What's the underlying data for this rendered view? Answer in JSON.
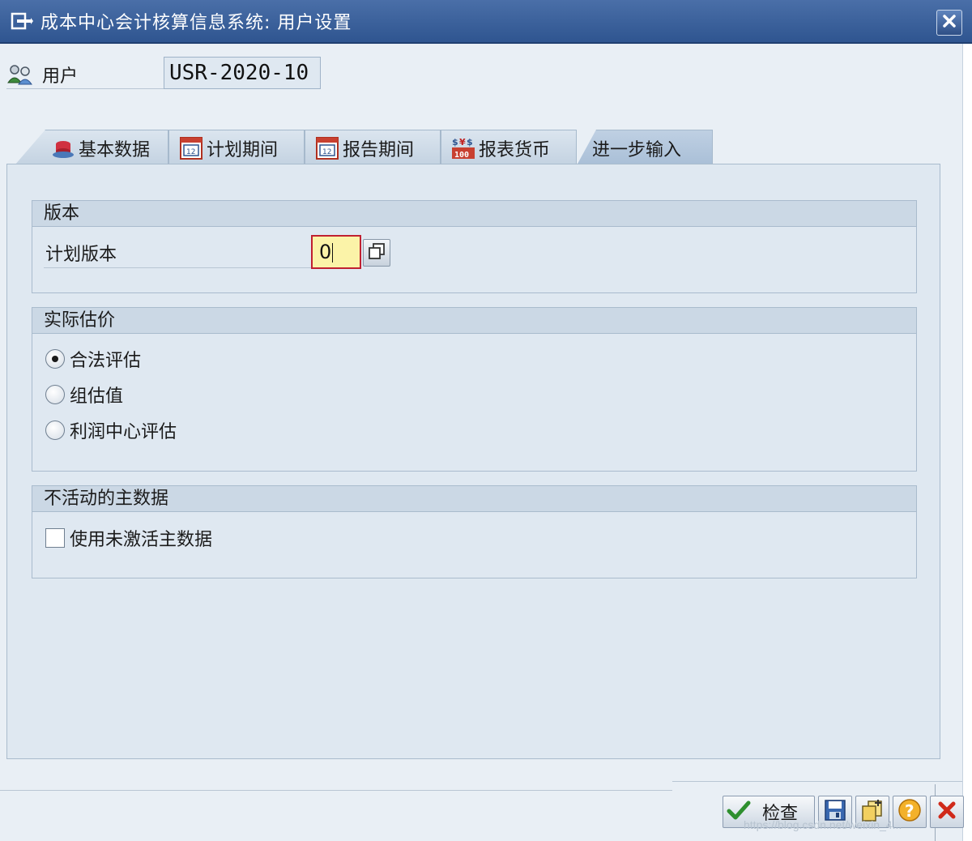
{
  "window": {
    "title": "成本中心会计核算信息系统: 用户设置",
    "app_icon": "edit-settings-icon",
    "close_icon": "close-icon"
  },
  "user": {
    "label": "用户",
    "value": "USR-2020-10",
    "icon": "users-icon"
  },
  "tabs": [
    {
      "label": "基本数据",
      "icon": "master-data-icon",
      "active": false
    },
    {
      "label": "计划期间",
      "icon": "calendar-icon",
      "active": false
    },
    {
      "label": "报告期间",
      "icon": "calendar-icon",
      "active": false
    },
    {
      "label": "报表货币",
      "icon": "currency-icon",
      "active": false
    },
    {
      "label": "进一步输入",
      "icon": "",
      "active": true
    }
  ],
  "groups": {
    "version": {
      "header": "版本",
      "plan_version_label": "计划版本",
      "plan_version_value": "0"
    },
    "actual_valuation": {
      "header": "实际估价",
      "options": [
        {
          "label": "合法评估",
          "checked": true
        },
        {
          "label": "组估值",
          "checked": false
        },
        {
          "label": "利润中心评估",
          "checked": false
        }
      ]
    },
    "inactive_master": {
      "header": "不活动的主数据",
      "checkbox_label": "使用未激活主数据",
      "checked": false
    }
  },
  "toolbar": {
    "check_label": "检查",
    "buttons": [
      "check-icon",
      "save-icon",
      "copy-icon",
      "help-icon",
      "cancel-icon"
    ]
  },
  "watermark": "https://blog.csdn.net/weixin_4..."
}
